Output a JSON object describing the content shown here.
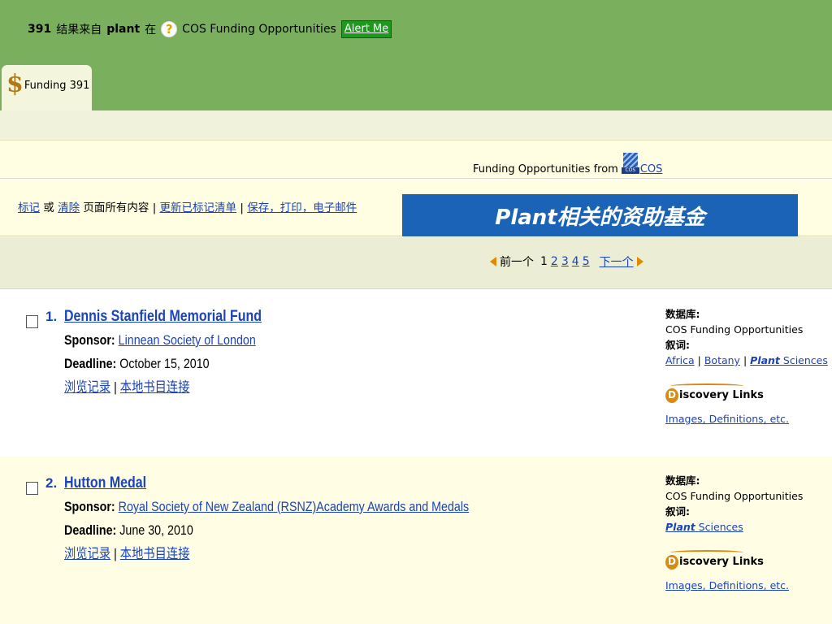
{
  "header": {
    "result_count": "391",
    "result_from": "结果来自",
    "query": "plant",
    "in_label": "在",
    "help_icon": "question-icon",
    "database": "COS Funding Opportunities",
    "alert_button": "Alert Me"
  },
  "tab": {
    "icon": "dollar-icon",
    "label": "Funding 391"
  },
  "source_line": {
    "text": "Funding Opportunities from",
    "logo_text": "COS",
    "link": "COS"
  },
  "toolbar": {
    "mark": "标记",
    "or": "或",
    "clear": "清除",
    "page_all": "页面所有内容",
    "sep1": "|",
    "update_marked": "更新已标记清单",
    "sep2": "|",
    "save_print_email": "保存，打印，电子邮件"
  },
  "banner": {
    "title": "Plant相关的资助基金"
  },
  "pager": {
    "prev": "前一个",
    "current": "1",
    "pages": [
      "2",
      "3",
      "4",
      "5"
    ],
    "next": "下一个"
  },
  "records": [
    {
      "num": "1.",
      "title": "Dennis Stanfield Memorial Fund",
      "sponsor_label": "Sponsor:",
      "sponsor": "Linnean Society of London",
      "deadline_label": "Deadline:",
      "deadline": "October 15, 2010",
      "browse_link": "浏览记录",
      "sep": "|",
      "local_link": "本地书目连接",
      "db_label": "数据库:",
      "db_value": "COS Funding Opportunities",
      "desc_label": "叙词:",
      "descriptors": {
        "africa": "Africa",
        "sep1": "|",
        "botany": "Botany",
        "sep2": "|",
        "plant": "Plant",
        "sciences": "Sciences"
      },
      "discovery_letter": "D",
      "discovery_text": "iscovery Links",
      "images_link": "Images, Definitions, etc."
    },
    {
      "num": "2.",
      "title": "Hutton Medal",
      "sponsor_label": "Sponsor:",
      "sponsor": "Royal Society of New Zealand (RSNZ)Academy Awards and Medals",
      "deadline_label": "Deadline:",
      "deadline": "June 30, 2010",
      "browse_link": "浏览记录",
      "sep": "|",
      "local_link": "本地书目连接",
      "db_label": "数据库:",
      "db_value": "COS Funding Opportunities",
      "desc_label": "叙词:",
      "descriptors": {
        "plant": "Plant",
        "sciences": "Sciences"
      },
      "discovery_letter": "D",
      "discovery_text": "iscovery Links",
      "images_link": "Images, Definitions, etc."
    }
  ],
  "colors": {
    "header_green": "#7aaf5e",
    "alert_green": "#1b9a1b",
    "banner_blue": "#1a63b6",
    "link_blue": "#1a44b8",
    "pager_arrow": "#e08a00"
  }
}
